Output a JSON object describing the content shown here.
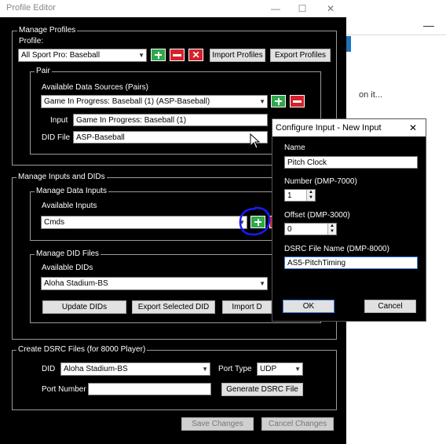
{
  "window": {
    "title": "Profile Editor",
    "minimize": "—",
    "maximize": "☐",
    "close": "✕"
  },
  "manage_profiles": {
    "group_label": "Manage Profiles",
    "profile_label": "Profile:",
    "profile_value": "All Sport Pro: Baseball",
    "import_label": "Import Profiles",
    "export_label": "Export Profiles",
    "pair": {
      "group_label": "Pair",
      "sources_label": "Available Data Sources (Pairs)",
      "sources_value": "Game In Progress: Baseball (1) (ASP-Baseball)",
      "input_label": "Input",
      "input_value": "Game In Progress: Baseball (1)",
      "did_file_label": "DID File",
      "did_file_value": "ASP-Baseball"
    }
  },
  "manage_inputs": {
    "group_label": "Manage Inputs and DIDs",
    "data_inputs": {
      "group_label": "Manage Data Inputs",
      "available_label": "Available Inputs",
      "available_value": "Cmds"
    },
    "did_files": {
      "group_label": "Manage DID Files",
      "available_label": "Available DIDs",
      "available_value": "Aloha Stadium-BS",
      "update_label": "Update DIDs",
      "export_label": "Export Selected DID",
      "import_label": "Import D"
    }
  },
  "dsrc": {
    "group_label": "Create DSRC Files (for 8000 Player)",
    "did_label": "DID",
    "did_value": "Aloha Stadium-BS",
    "port_type_label": "Port Type",
    "port_type_value": "UDP",
    "port_number_label": "Port Number",
    "port_number_value": "",
    "generate_label": "Generate DSRC File"
  },
  "footer": {
    "save_label": "Save Changes",
    "cancel_label": "Cancel Changes"
  },
  "dialog": {
    "title": "Configure Input - New Input",
    "close": "✕",
    "name_label": "Name",
    "name_value": "Pitch Clock",
    "number_label": "Number (DMP-7000)",
    "number_value": "1",
    "offset_label": "Offset (DMP-3000)",
    "offset_value": "0",
    "dsrc_label": "DSRC File Name (DMP-8000)",
    "dsrc_value": "AS5-PitchTiming",
    "ok_label": "OK",
    "cancel_label": "Cancel"
  },
  "background": {
    "snippet": "on it..."
  },
  "colors": {
    "accent_add": "#2ea84a",
    "accent_remove": "#d6202a",
    "annotation": "#1a1aff"
  }
}
